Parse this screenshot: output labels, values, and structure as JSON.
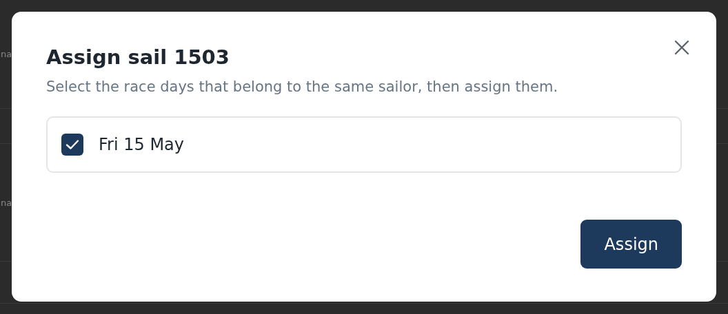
{
  "background_rows": [
    {
      "text": "na"
    },
    {
      "text": "na"
    }
  ],
  "dialog": {
    "title": "Assign sail 1503",
    "description": "Select the race days that belong to the same sailor, then assign them.",
    "options": [
      {
        "label": "Fri 15 May",
        "checked": true
      }
    ],
    "buttons": [
      {
        "label": "Assign",
        "kind": "primary"
      }
    ]
  }
}
